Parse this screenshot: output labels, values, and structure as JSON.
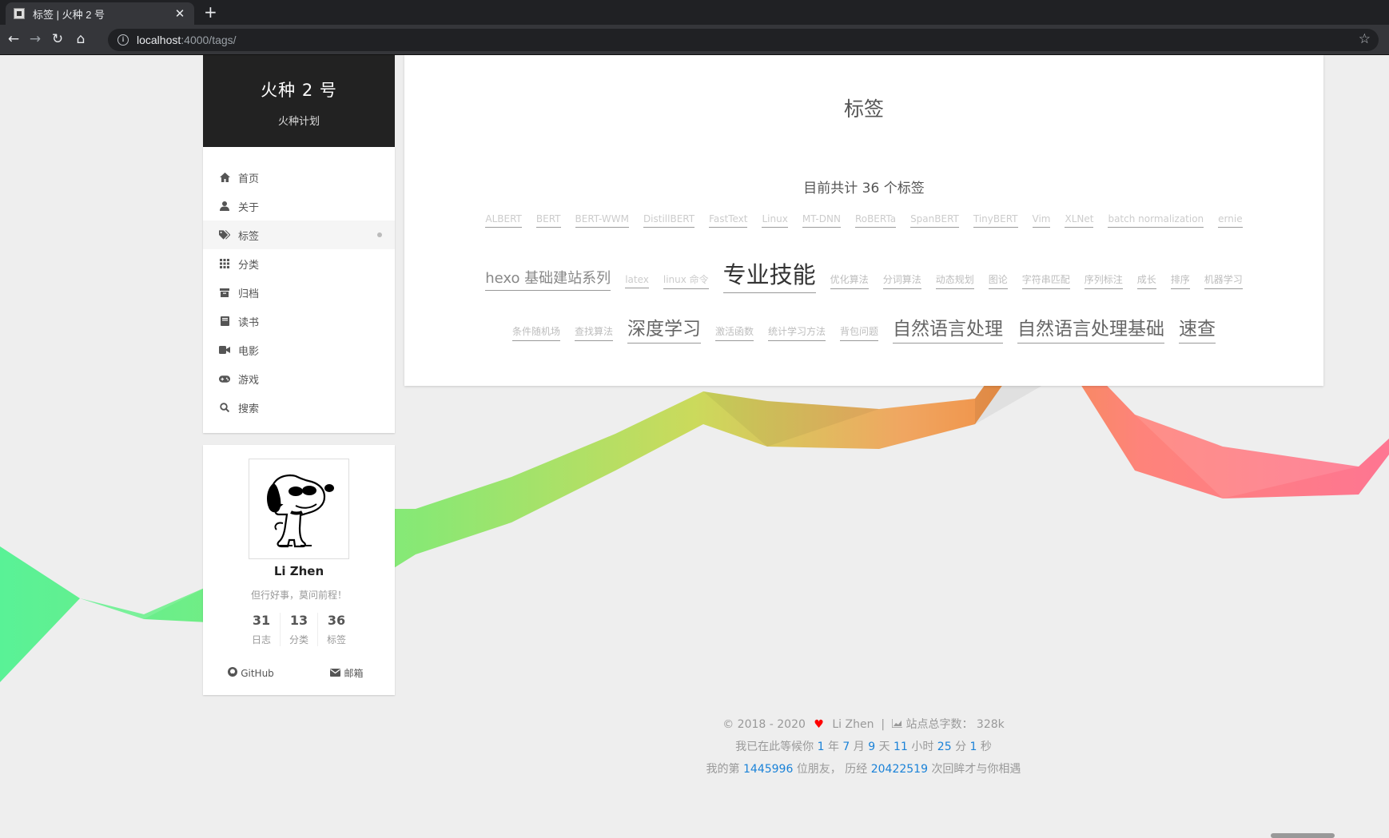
{
  "browser": {
    "tab_title": "标签 | 火种 2 号",
    "new_tab": "+",
    "close": "✕",
    "url_host": "localhost",
    "url_path": ":4000/tags/"
  },
  "site": {
    "title": "火种 2 号",
    "subtitle": "火种计划"
  },
  "menu": [
    {
      "label": "首页",
      "icon": "home-icon"
    },
    {
      "label": "关于",
      "icon": "user-icon"
    },
    {
      "label": "标签",
      "icon": "tags-icon"
    },
    {
      "label": "分类",
      "icon": "grid-icon"
    },
    {
      "label": "归档",
      "icon": "archive-icon"
    },
    {
      "label": "读书",
      "icon": "book-icon"
    },
    {
      "label": "电影",
      "icon": "video-icon"
    },
    {
      "label": "游戏",
      "icon": "gamepad-icon"
    },
    {
      "label": "搜索",
      "icon": "search-icon"
    }
  ],
  "author": {
    "name": "Li Zhen",
    "description": "但行好事，莫问前程！",
    "stats": [
      {
        "count": "31",
        "label": "日志"
      },
      {
        "count": "13",
        "label": "分类"
      },
      {
        "count": "36",
        "label": "标签"
      }
    ],
    "links": [
      {
        "label": "GitHub",
        "icon": "github-icon"
      },
      {
        "label": "邮箱",
        "icon": "envelope-icon"
      }
    ]
  },
  "page": {
    "title": "标签",
    "count_text": "目前共计 36 个标签"
  },
  "tag_rows": [
    [
      {
        "name": "ALBERT",
        "size": 1
      },
      {
        "name": "BERT",
        "size": 1
      },
      {
        "name": "BERT-WWM",
        "size": 1
      },
      {
        "name": "DistillBERT",
        "size": 1
      },
      {
        "name": "FastText",
        "size": 1
      },
      {
        "name": "Linux",
        "size": 1
      },
      {
        "name": "MT-DNN",
        "size": 1
      },
      {
        "name": "RoBERTa",
        "size": 1
      },
      {
        "name": "SpanBERT",
        "size": 1
      },
      {
        "name": "TinyBERT",
        "size": 1
      },
      {
        "name": "Vim",
        "size": 1
      },
      {
        "name": "XLNet",
        "size": 1
      },
      {
        "name": "batch normalization",
        "size": 1
      },
      {
        "name": "ernie",
        "size": 1
      }
    ],
    [
      {
        "name": "hexo 基础建站系列",
        "size": 3
      },
      {
        "name": "latex",
        "size": 1
      },
      {
        "name": "linux 命令",
        "size": 1
      },
      {
        "name": "专业技能",
        "size": 5
      },
      {
        "name": "优化算法",
        "size": 2
      },
      {
        "name": "分词算法",
        "size": 2
      },
      {
        "name": "动态规划",
        "size": 2
      },
      {
        "name": "图论",
        "size": 2
      },
      {
        "name": "字符串匹配",
        "size": 2
      },
      {
        "name": "序列标注",
        "size": 2
      },
      {
        "name": "成长",
        "size": 2
      },
      {
        "name": "排序",
        "size": 2
      },
      {
        "name": "机器学习",
        "size": 2
      }
    ],
    [
      {
        "name": "条件随机场",
        "size": 2
      },
      {
        "name": "查找算法",
        "size": 2
      },
      {
        "name": "深度学习",
        "size": 4
      },
      {
        "name": "激活函数",
        "size": 2
      },
      {
        "name": "统计学习方法",
        "size": 2
      },
      {
        "name": "背包问题",
        "size": 2
      },
      {
        "name": "自然语言处理",
        "size": 4
      },
      {
        "name": "自然语言处理基础",
        "size": 4
      },
      {
        "name": "速查",
        "size": 4
      }
    ]
  ],
  "footer": {
    "copyright": "© 2018 - 2020",
    "heart": "♥",
    "author": "Li Zhen",
    "separator": "|",
    "words_label": "站点总字数：",
    "words_value": "328k",
    "wait_prefix": "我已在此等候你",
    "wait_parts": [
      {
        "num": "1",
        "unit": "年"
      },
      {
        "num": "7",
        "unit": "月"
      },
      {
        "num": "9",
        "unit": "天"
      },
      {
        "num": "11",
        "unit": "小时"
      },
      {
        "num": "25",
        "unit": "分"
      },
      {
        "num": "1",
        "unit": "秒"
      }
    ],
    "visitor_prefix": "我的第",
    "visitor_num": "1445996",
    "visitor_mid": "位朋友，  历经",
    "views_num": "20422519",
    "visitor_suffix": "次回眸才与你相遇"
  },
  "colors": {
    "ribbon_left": "#4cf28f",
    "ribbon_mid": "#c8d84f",
    "ribbon_orange": "#f08a3a",
    "ribbon_right": "#ff6b8a",
    "link_blue": "#1a82d8"
  }
}
